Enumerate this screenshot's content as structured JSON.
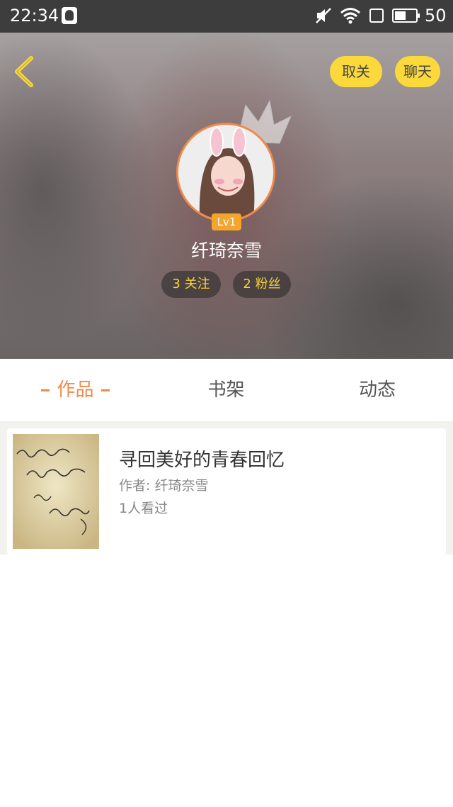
{
  "status_bar": {
    "time": "22:34",
    "battery_level": "50"
  },
  "header": {
    "unfollow_label": "取关",
    "chat_label": "聊天",
    "level": "Lv1",
    "username": "纤琦奈雪",
    "following": "3 关注",
    "followers": "2 粉丝"
  },
  "tabs": [
    {
      "label": "作品",
      "active": true
    },
    {
      "label": "书架",
      "active": false
    },
    {
      "label": "动态",
      "active": false
    }
  ],
  "books": [
    {
      "title": "寻回美好的青春回忆",
      "author": "作者: 纤琦奈雪",
      "views": "1人看过"
    }
  ],
  "colors": {
    "accent_yellow": "#fcd93b",
    "accent_orange": "#f08a4a",
    "stat_text": "#f6d23a"
  }
}
